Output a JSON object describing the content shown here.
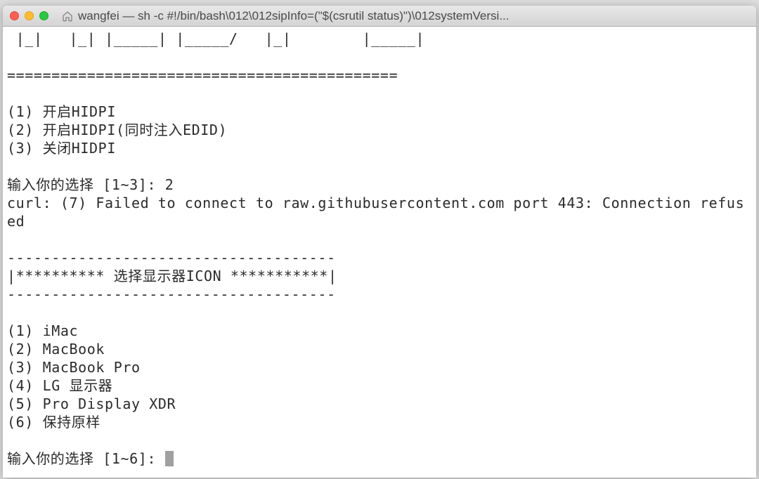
{
  "window": {
    "title": "wangfei — sh -c #!/bin/bash\\012\\012sipInfo=(\"$(csrutil status)\")\\012systemVersi..."
  },
  "terminal": {
    "lines": {
      "ascii": " |_|   |_| |_____| |_____/   |_|        |_____|",
      "separator": "============================================",
      "opt1": "(1) 开启HIDPI",
      "opt2": "(2) 开启HIDPI(同时注入EDID)",
      "opt3": "(3) 关闭HIDPI",
      "prompt1": "输入你的选择 [1~3]: 2",
      "curl_err": "curl: (7) Failed to connect to raw.githubusercontent.com port 443: Connection refused",
      "dashline": "-------------------------------------",
      "icon_header": "|********** 选择显示器ICON ***********|",
      "dashline2": "-------------------------------------",
      "iopt1": "(1) iMac",
      "iopt2": "(2) MacBook",
      "iopt3": "(3) MacBook Pro",
      "iopt4": "(4) LG 显示器",
      "iopt5": "(5) Pro Display XDR",
      "iopt6": "(6) 保持原样",
      "prompt2": "输入你的选择 [1~6]: "
    }
  }
}
